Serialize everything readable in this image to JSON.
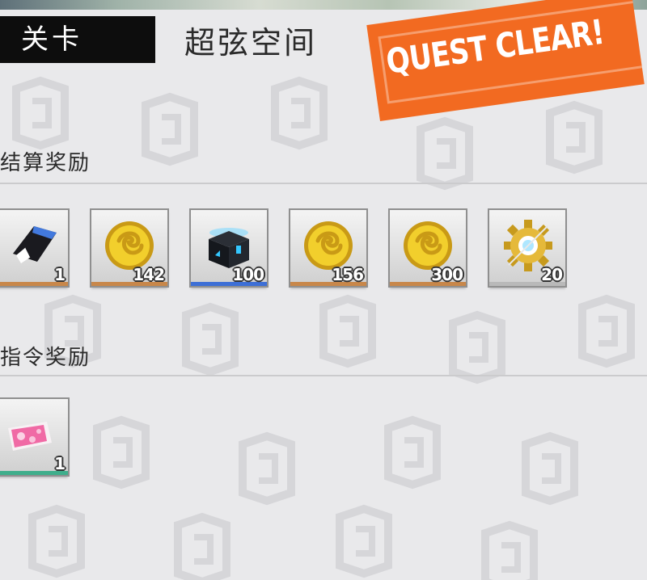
{
  "header": {
    "tag_label": "关卡",
    "stage_name": "超弦空间",
    "stamp_text": "QUEST CLEAR!"
  },
  "sections": {
    "settlement": {
      "title": "结算奖励",
      "items": [
        {
          "icon": "black-card-icon",
          "quantity": "1",
          "rarity_color": "#c8874a"
        },
        {
          "icon": "gold-coin-icon",
          "quantity": "142",
          "rarity_color": "#c8874a"
        },
        {
          "icon": "blue-supply-box-icon",
          "quantity": "100",
          "rarity_color": "#3d6fd6"
        },
        {
          "icon": "gold-coin-icon",
          "quantity": "156",
          "rarity_color": "#c8874a"
        },
        {
          "icon": "gold-coin-icon",
          "quantity": "300",
          "rarity_color": "#c8874a"
        },
        {
          "icon": "gold-gear-crystal-icon",
          "quantity": "20",
          "rarity_color": "#b9b9b9"
        }
      ]
    },
    "command": {
      "title": "指令奖励",
      "items": [
        {
          "icon": "pink-ticket-icon",
          "quantity": "1",
          "rarity_color": "#3fae8c"
        }
      ]
    }
  },
  "colors": {
    "background": "#e9e9eb",
    "stamp": "#f26a21",
    "tag_background": "#0d0d0d"
  }
}
